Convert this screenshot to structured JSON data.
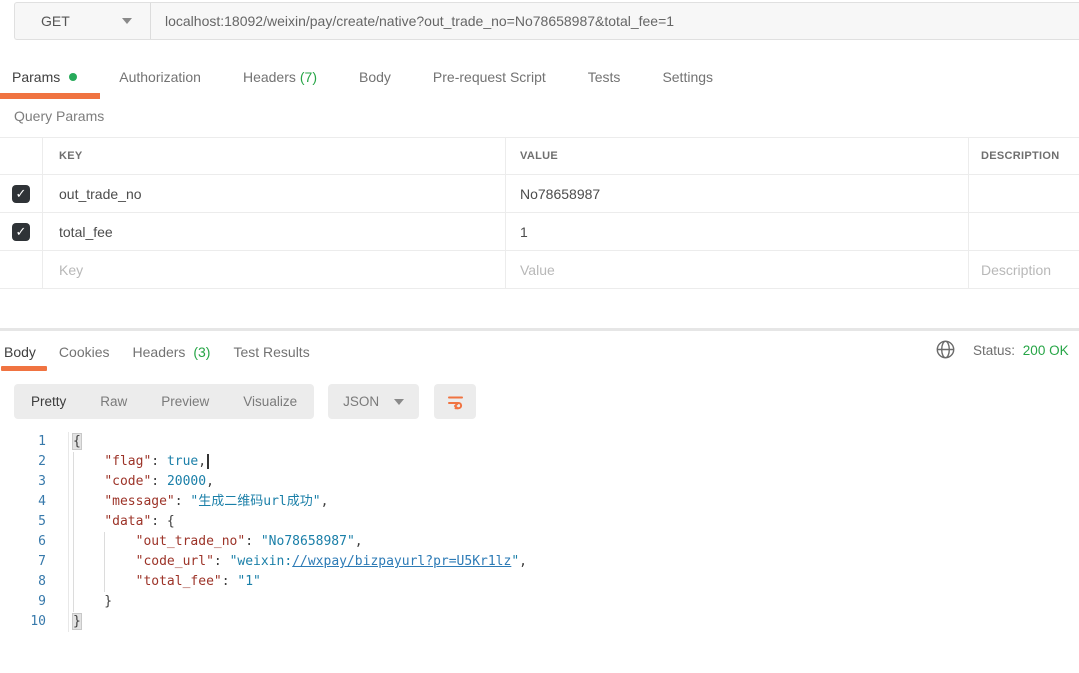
{
  "request": {
    "method": "GET",
    "url": "localhost:18092/weixin/pay/create/native?out_trade_no=No78658987&total_fee=1",
    "tabs": {
      "params": "Params",
      "authorization": "Authorization",
      "headers": "Headers",
      "headers_count": "(7)",
      "body": "Body",
      "prerequest": "Pre-request Script",
      "tests": "Tests",
      "settings": "Settings"
    }
  },
  "params": {
    "section_title": "Query Params",
    "columns": {
      "key": "KEY",
      "value": "VALUE",
      "description": "DESCRIPTION"
    },
    "rows": [
      {
        "checked": true,
        "key": "out_trade_no",
        "value": "No78658987",
        "description": ""
      },
      {
        "checked": true,
        "key": "total_fee",
        "value": "1",
        "description": ""
      },
      {
        "checked": false,
        "key": "",
        "value": "",
        "description": "",
        "key_placeholder": "Key",
        "value_placeholder": "Value",
        "description_placeholder": "Description"
      }
    ]
  },
  "response": {
    "tabs": {
      "body": "Body",
      "cookies": "Cookies",
      "headers": "Headers",
      "headers_count": "(3)",
      "test_results": "Test Results"
    },
    "status_label": "Status:",
    "status_value": "200 OK",
    "toolbar": {
      "views": [
        "Pretty",
        "Raw",
        "Preview",
        "Visualize"
      ],
      "active_view": "Pretty",
      "language": "JSON"
    }
  },
  "icons": {
    "method_caret": "caret-down",
    "language_caret": "caret-down",
    "globe": "globe",
    "wrap_text": "wrap-text",
    "checkbox_check": "✓",
    "params_active_dot": "green-dot"
  },
  "colors": {
    "accent_orange": "#f07341",
    "success_green": "#26a546",
    "json_key": "#9c3328",
    "json_value": "#1a7fa8",
    "json_link": "#2d7bb6"
  },
  "code": {
    "lines": [
      {
        "n": "1",
        "tokens": [
          {
            "t": "hl",
            "v": "{"
          }
        ]
      },
      {
        "n": "2",
        "tokens": [
          {
            "t": "p",
            "v": "    "
          },
          {
            "t": "key",
            "v": "\"flag\""
          },
          {
            "t": "p",
            "v": ": "
          },
          {
            "t": "val",
            "v": "true"
          },
          {
            "t": "p",
            "v": ","
          },
          {
            "t": "cursor",
            "v": ""
          }
        ]
      },
      {
        "n": "3",
        "tokens": [
          {
            "t": "p",
            "v": "    "
          },
          {
            "t": "key",
            "v": "\"code\""
          },
          {
            "t": "p",
            "v": ": "
          },
          {
            "t": "val",
            "v": "20000"
          },
          {
            "t": "p",
            "v": ","
          }
        ]
      },
      {
        "n": "4",
        "tokens": [
          {
            "t": "p",
            "v": "    "
          },
          {
            "t": "key",
            "v": "\"message\""
          },
          {
            "t": "p",
            "v": ": "
          },
          {
            "t": "val",
            "v": "\"生成二维码url成功\""
          },
          {
            "t": "p",
            "v": ","
          }
        ]
      },
      {
        "n": "5",
        "tokens": [
          {
            "t": "p",
            "v": "    "
          },
          {
            "t": "key",
            "v": "\"data\""
          },
          {
            "t": "p",
            "v": ": {"
          }
        ]
      },
      {
        "n": "6",
        "tokens": [
          {
            "t": "p",
            "v": "        "
          },
          {
            "t": "key",
            "v": "\"out_trade_no\""
          },
          {
            "t": "p",
            "v": ": "
          },
          {
            "t": "val",
            "v": "\"No78658987\""
          },
          {
            "t": "p",
            "v": ","
          }
        ]
      },
      {
        "n": "7",
        "tokens": [
          {
            "t": "p",
            "v": "        "
          },
          {
            "t": "key",
            "v": "\"code_url\""
          },
          {
            "t": "p",
            "v": ": "
          },
          {
            "t": "val",
            "v": "\"weixin:"
          },
          {
            "t": "link",
            "v": "//wxpay/bizpayurl?pr=U5Kr1lz"
          },
          {
            "t": "val",
            "v": "\""
          },
          {
            "t": "p",
            "v": ","
          }
        ]
      },
      {
        "n": "8",
        "tokens": [
          {
            "t": "p",
            "v": "        "
          },
          {
            "t": "key",
            "v": "\"total_fee\""
          },
          {
            "t": "p",
            "v": ": "
          },
          {
            "t": "val",
            "v": "\"1\""
          }
        ]
      },
      {
        "n": "9",
        "tokens": [
          {
            "t": "p",
            "v": "    }"
          }
        ]
      },
      {
        "n": "10",
        "tokens": [
          {
            "t": "hl",
            "v": "}"
          }
        ]
      }
    ]
  }
}
